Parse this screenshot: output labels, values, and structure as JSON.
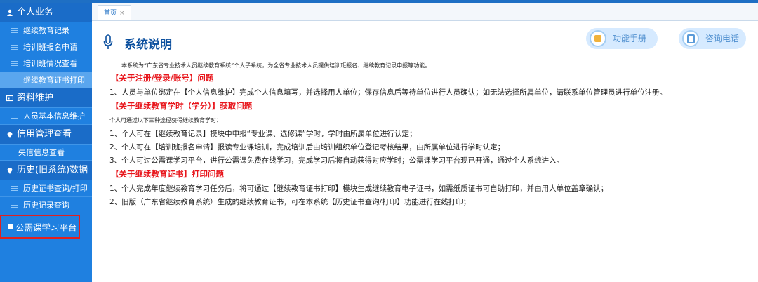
{
  "sidebar": {
    "sections": [
      {
        "header": "个人业务",
        "items": [
          "继续教育记录",
          "培训班报名申请",
          "培训班情况查看",
          "继续教育证书打印"
        ]
      },
      {
        "header": "资料维护",
        "items": [
          "人员基本信息维护"
        ]
      },
      {
        "header": "信用管理查看",
        "items": [
          "失信信息查看"
        ]
      },
      {
        "header": "历史(旧系统)数据",
        "items": [
          "历史证书查询/打印",
          "历史记录查询"
        ]
      }
    ],
    "platform": "公需课学习平台"
  },
  "tabs": {
    "home": "首页",
    "close": "×"
  },
  "main": {
    "title": "系统说明",
    "buttons": {
      "manual": "功能手册",
      "phone": "咨询电话"
    },
    "intro": "本系统为“广东省专业技术人员继续教育系统”个人子系统，为全省专业技术人员提供培训班报名、继续教育记录申报等功能。",
    "sec1_head": "【关于注册/登录/账号】问题",
    "sec1_item1": "1、人员与单位绑定在【个人信息维护】完成个人信息填写，并选择用人单位；保存信息后等待单位进行人员确认；如无法选择所属单位，请联系单位管理员进行单位注册。",
    "sec2_head": "【关于继续教育学时（学分）】获取问题",
    "sec2_sub": "个人可通过以下三种途径获得继续教育学时：",
    "sec2_item1": "1、个人可在【继续教育记录】模块中申报“专业课、选修课”学时，学时由所属单位进行认定；",
    "sec2_item2": "2、个人可在【培训班报名申请】报读专业课培训，完成培训后由培训组织单位登记考核结果，由所属单位进行学时认定；",
    "sec2_item3": "3、个人可过公需课学习平台，进行公需课免费在线学习，完成学习后将自动获得对应学时；公需课学习平台现已开通，通过个人系统进入。",
    "sec3_head": "【关于继续教育证书】打印问题",
    "sec3_item1": "1、个人完成年度继续教育学习任务后，将可通过【继续教育证书打印】模块生成继续教育电子证书，如需纸质证书可自助打印，并由用人单位盖章确认；",
    "sec3_item2": "2、旧版（广东省继续教育系统）生成的继续教育证书，可在本系统【历史证书查询/打印】功能进行在线打印；"
  }
}
